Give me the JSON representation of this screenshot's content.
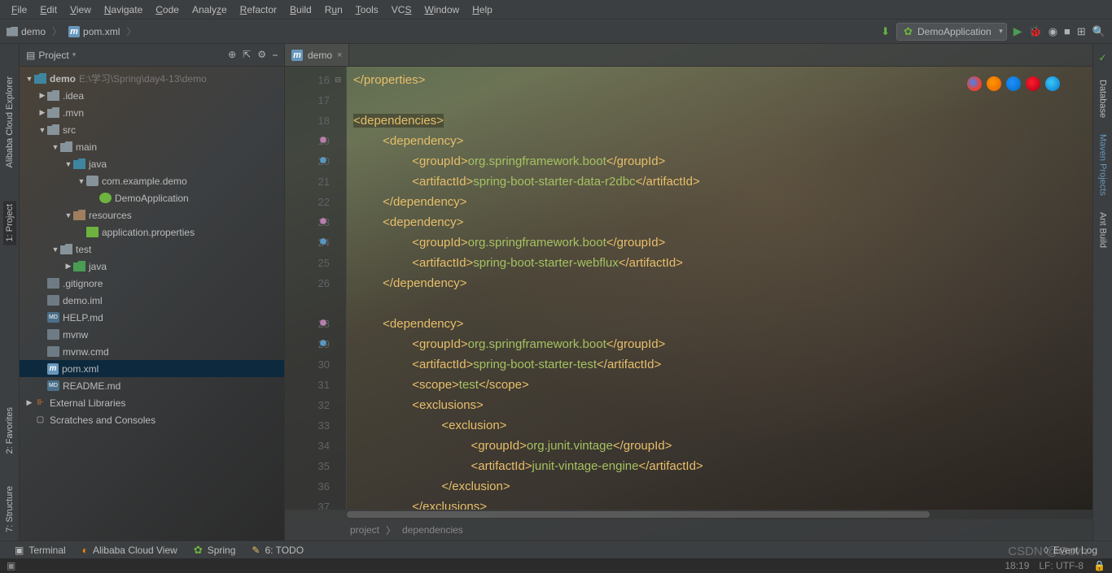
{
  "menu": {
    "file": "File",
    "edit": "Edit",
    "view": "View",
    "navigate": "Navigate",
    "code": "Code",
    "analyze": "Analyze",
    "refactor": "Refactor",
    "build": "Build",
    "run": "Run",
    "tools": "Tools",
    "vcs": "VCS",
    "window": "Window",
    "help": "Help"
  },
  "breadcrumb": {
    "project": "demo",
    "file": "pom.xml"
  },
  "runConfig": {
    "name": "DemoApplication"
  },
  "panel": {
    "title": "Project"
  },
  "tree": {
    "root": {
      "name": "demo",
      "path": "E:\\学习\\Spring\\day4-13\\demo"
    },
    "idea": ".idea",
    "mvn": ".mvn",
    "src": "src",
    "main": "main",
    "java": "java",
    "pkg": "com.example.demo",
    "app": "DemoApplication",
    "res": "resources",
    "props": "application.properties",
    "test": "test",
    "java2": "java",
    "git": ".gitignore",
    "iml": "demo.iml",
    "help": "HELP.md",
    "mvnw": "mvnw",
    "mvnwcmd": "mvnw.cmd",
    "pom": "pom.xml",
    "readme": "README.md",
    "ext": "External Libraries",
    "scratch": "Scratches and Consoles"
  },
  "tab": {
    "name": "demo"
  },
  "code": {
    "startLine": 16,
    "bcrumb1": "project",
    "bcrumb2": "dependencies"
  },
  "leftTools": {
    "cloud": "Alibaba Cloud Explorer",
    "project": "1: Project",
    "fav": "2: Favorites",
    "struct": "7: Structure"
  },
  "rightTools": {
    "db": "Database",
    "maven": "Maven Projects",
    "ant": "Ant Build"
  },
  "bottomTools": {
    "terminal": "Terminal",
    "cloudview": "Alibaba Cloud View",
    "spring": "Spring",
    "todo": "6: TODO",
    "eventlog": "Event Log"
  },
  "status": {
    "pos": "18:19",
    "enc": "LF:  UTF-8"
  },
  "watermark": "CSDN @Guvh"
}
